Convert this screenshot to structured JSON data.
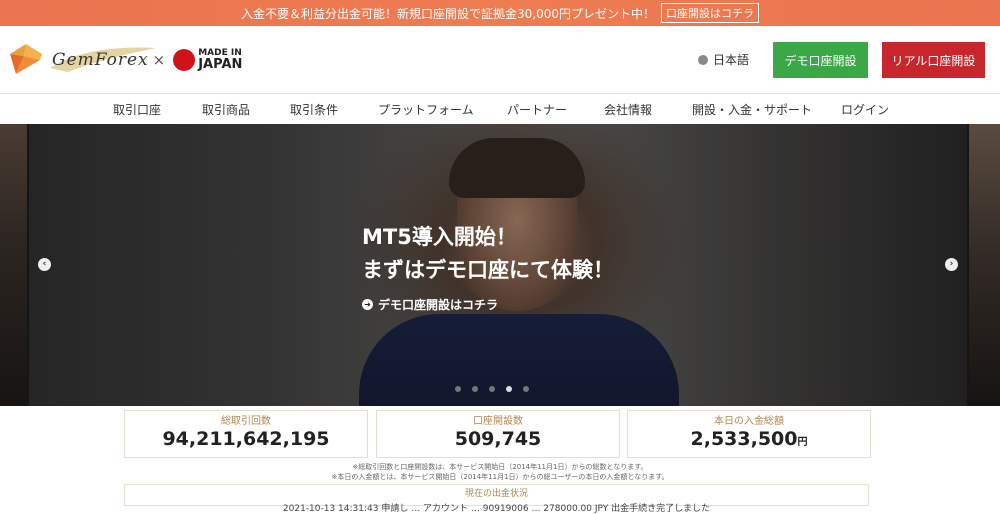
{
  "promo": {
    "text": "入金不要＆利益分出金可能！新規口座開設で証拠金30,000円プレゼント中！",
    "link": "口座開設はコチラ"
  },
  "header": {
    "logo_text": "GemForex",
    "cross": "×",
    "mij_line1": "MADE IN",
    "mij_line2": "JAPAN",
    "language": "日本語",
    "demo_button": "デモ口座開設",
    "real_button": "リアル口座開設"
  },
  "nav": {
    "items": [
      "取引口座",
      "取引商品",
      "取引条件",
      "プラットフォーム",
      "パートナー",
      "会社情報",
      "開設・入金・サポート",
      "ログイン"
    ]
  },
  "hero": {
    "title_line1": "MT5導入開始！",
    "title_line2": "まずはデモ口座にて体験！",
    "link": "デモ口座開設はコチラ",
    "prev_arrow": "‹",
    "next_arrow": "›",
    "slide_count": 5,
    "active_slide": 4
  },
  "stats": {
    "trades_label": "総取引回数",
    "trades_value": "94,211,642,195",
    "accounts_label": "口座開設数",
    "accounts_value": "509,745",
    "deposit_label": "本日の入金総額",
    "deposit_value": "2,533,500",
    "deposit_unit": "円"
  },
  "notes": {
    "line1": "※総取引回数と口座開設数は、本サービス開始日（2014年11月1日）からの総数となります。",
    "line2": "※本日の入金額とは、本サービス開始日（2014年11月1日）からの総ユーザーの本日の入金額となります。"
  },
  "withdraw": {
    "title": "現在の出金状況",
    "row": "2021-10-13 14:31:43 申請し … アカウント … 90919006 … 278000.00 JPY 出金手続き完了しました"
  },
  "colors": {
    "promo_bg": "#ee7c52",
    "demo_green": "#3aa846",
    "real_red": "#c6262c",
    "gold": "#b08850"
  }
}
